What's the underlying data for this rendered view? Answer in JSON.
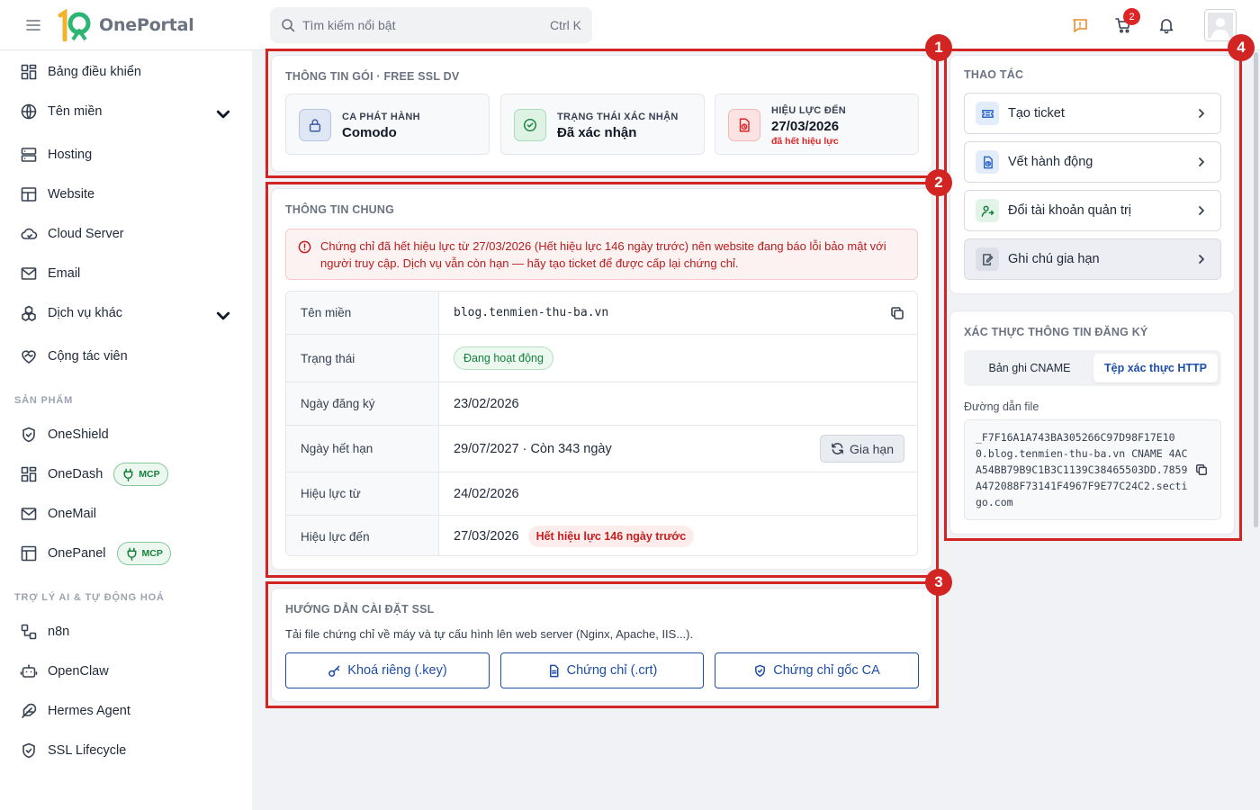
{
  "header": {
    "brand_mark": "1O",
    "brand": "OnePortal",
    "search_placeholder": "Tìm kiếm nổi bật",
    "search_shortcut": "Ctrl K",
    "cart_count": "2"
  },
  "sidebar": {
    "items": [
      {
        "label": "Bảng điều khiển",
        "icon": "dashboard-icon"
      },
      {
        "label": "Tên miền",
        "icon": "globe-icon",
        "expandable": true
      },
      {
        "label": "Hosting",
        "icon": "server-icon"
      },
      {
        "label": "Website",
        "icon": "layout-icon"
      },
      {
        "label": "Cloud Server",
        "icon": "cloud-icon"
      },
      {
        "label": "Email",
        "icon": "mail-icon"
      },
      {
        "label": "Dịch vụ khác",
        "icon": "boxes-icon",
        "expandable": true
      },
      {
        "label": "Cộng tác viên",
        "icon": "handshake-icon"
      }
    ],
    "products_title": "SẢN PHẨM",
    "products": [
      {
        "label": "OneShield",
        "icon": "shield-icon"
      },
      {
        "label": "OneDash",
        "icon": "dashboard-icon",
        "badge": "MCP"
      },
      {
        "label": "OneMail",
        "icon": "mail-icon"
      },
      {
        "label": "OnePanel",
        "icon": "panel-icon",
        "badge": "MCP"
      }
    ],
    "ai_title": "TRỢ LÝ AI & TỰ ĐỘNG HOÁ",
    "ai_items": [
      {
        "label": "n8n",
        "icon": "workflow-icon"
      },
      {
        "label": "OpenClaw",
        "icon": "bot-icon"
      },
      {
        "label": "Hermes Agent",
        "icon": "feather-icon"
      },
      {
        "label": "SSL Lifecycle",
        "icon": "shield-check-icon"
      }
    ]
  },
  "package": {
    "title": "THÔNG TIN GÓI · FREE SSL DV",
    "stats": [
      {
        "label": "CA PHÁT HÀNH",
        "value": "Comodo",
        "icon": "lock-icon",
        "color": "#3b5ba9"
      },
      {
        "label": "TRẠNG THÁI XÁC NHẬN",
        "value": "Đã xác nhận",
        "icon": "check-circle-icon",
        "color": "#15803d"
      },
      {
        "label": "HIỆU LỰC ĐẾN",
        "value": "27/03/2026",
        "sub": "đã hết hiệu lực",
        "icon": "expired-doc-icon",
        "color": "#dc2626"
      }
    ]
  },
  "general": {
    "title": "THÔNG TIN CHUNG",
    "alert": "Chứng chỉ đã hết hiệu lực từ 27/03/2026 (Hết hiệu lực 146 ngày trước) nên website đang báo lỗi bảo mật với người truy cập. Dịch vụ vẫn còn hạn — hãy tạo ticket để được cấp lại chứng chỉ.",
    "rows": [
      {
        "key": "Tên miền",
        "value": "blog.tenmien-thu-ba.vn"
      },
      {
        "key": "Trạng thái",
        "value": "Đang hoạt động"
      },
      {
        "key": "Ngày đăng ký",
        "value": "23/02/2026"
      },
      {
        "key": "Ngày hết hạn",
        "value": "29/07/2027 · Còn 343 ngày"
      },
      {
        "key": "Hiệu lực từ",
        "value": "24/02/2026"
      },
      {
        "key": "Hiệu lực đến",
        "value": "27/03/2026",
        "tag": "Hết hiệu lực 146 ngày trước"
      }
    ],
    "renew_label": "Gia hạn"
  },
  "guide": {
    "title": "HƯỚNG DẪN CÀI ĐẶT SSL",
    "text": "Tải file chứng chỉ về máy và tự cấu hình lên web server (Nginx, Apache, IIS...).",
    "buttons": [
      {
        "label": "Khoá riêng (.key)",
        "icon": "key-icon"
      },
      {
        "label": "Chứng chỉ (.crt)",
        "icon": "file-icon"
      },
      {
        "label": "Chứng chỉ gốc CA",
        "icon": "shield-icon"
      }
    ]
  },
  "actions": {
    "title": "THAO TÁC",
    "items": [
      {
        "label": "Tạo ticket",
        "icon": "ticket-icon"
      },
      {
        "label": "Vết hành động",
        "icon": "history-icon"
      },
      {
        "label": "Đổi tài khoản quản trị",
        "icon": "user-swap-icon"
      },
      {
        "label": "Ghi chú gia hạn",
        "icon": "note-icon",
        "active": true
      }
    ]
  },
  "verify": {
    "title": "XÁC THỰC THÔNG TIN ĐĂNG KÝ",
    "tabs": [
      "Bản ghi CNAME",
      "Tệp xác thực HTTP"
    ],
    "active_tab": "Tệp xác thực HTTP",
    "path_label": "Đường dẫn file",
    "path_value": "_F7F16A1A743BA305266C97D98F17E10 0.blog.tenmien-thu-ba.vn CNAME 4ACA54BB79B9C1B3C1139C38465503DD.7859A472088F73141F4967F9E77C24C2.sectigo.com"
  },
  "highlights": [
    "1",
    "2",
    "3",
    "4"
  ]
}
